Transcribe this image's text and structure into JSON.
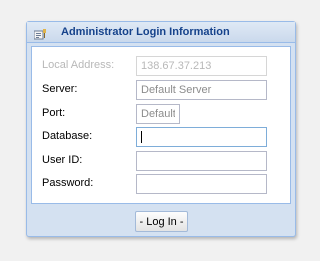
{
  "panel": {
    "title": "Administrator Login Information",
    "icon": "login-form-icon"
  },
  "form": {
    "local_address": {
      "label": "Local Address:",
      "value": "138.67.37.213"
    },
    "server": {
      "label": "Server:",
      "placeholder": "Default Server"
    },
    "port": {
      "label": "Port:",
      "placeholder": "Default"
    },
    "database": {
      "label": "Database:",
      "value": ""
    },
    "user_id": {
      "label": "User ID:",
      "value": ""
    },
    "password": {
      "label": "Password:",
      "value": ""
    }
  },
  "footer": {
    "login_label": "- Log In -"
  }
}
